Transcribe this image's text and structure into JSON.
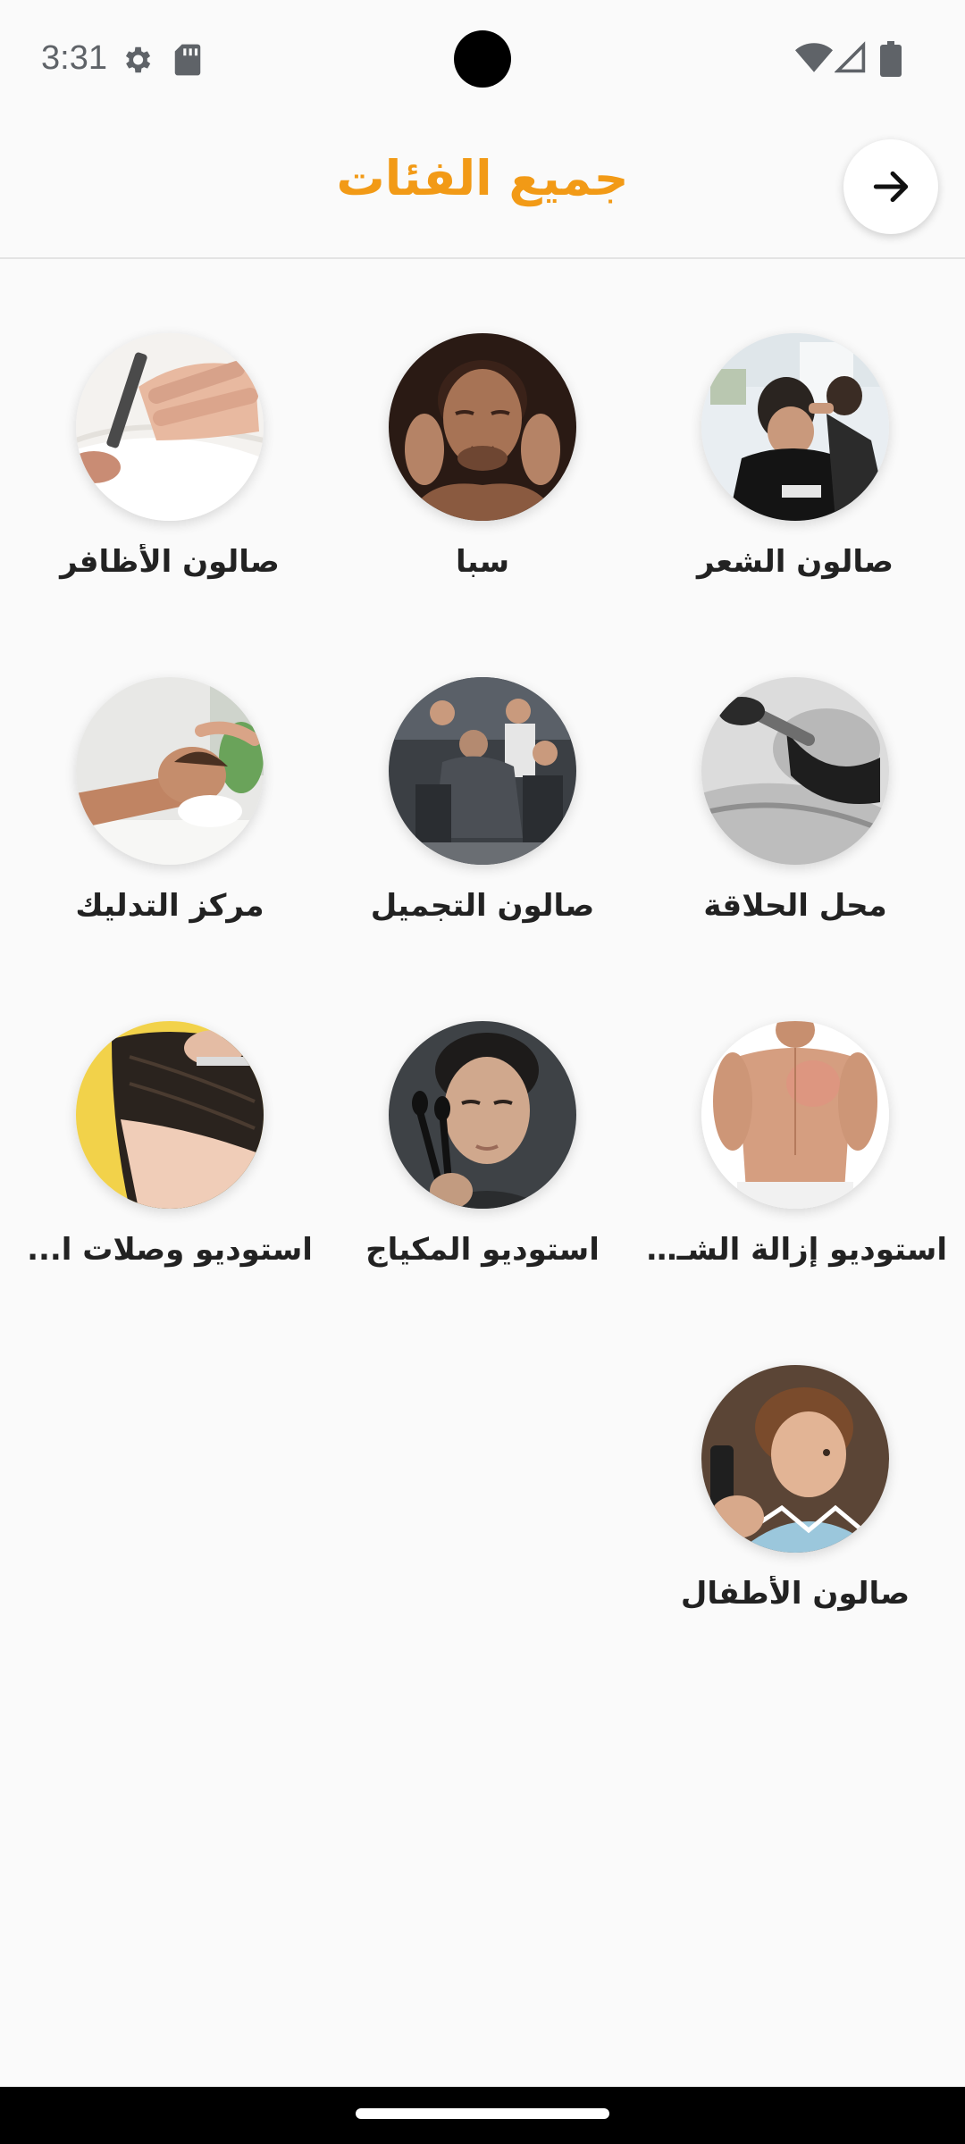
{
  "status_bar": {
    "time": "3:31",
    "icons": [
      "gear-icon",
      "sd-card-icon",
      "wifi-icon",
      "signal-icon",
      "battery-icon"
    ]
  },
  "header": {
    "title": "جميع الفئات",
    "title_color": "#f29a16",
    "back_icon": "arrow-right-icon"
  },
  "categories": [
    {
      "label": "صالون الشعر"
    },
    {
      "label": "سبا"
    },
    {
      "label": "صالون الأظافر"
    },
    {
      "label": "محل الحلاقة"
    },
    {
      "label": "صالون التجميل"
    },
    {
      "label": "مركز التدليك"
    },
    {
      "label": "استوديو إزالة الشـ..."
    },
    {
      "label": "استوديو المكياج"
    },
    {
      "label": "استوديو وصلات ا..."
    },
    {
      "label": "صالون الأطفال"
    }
  ]
}
